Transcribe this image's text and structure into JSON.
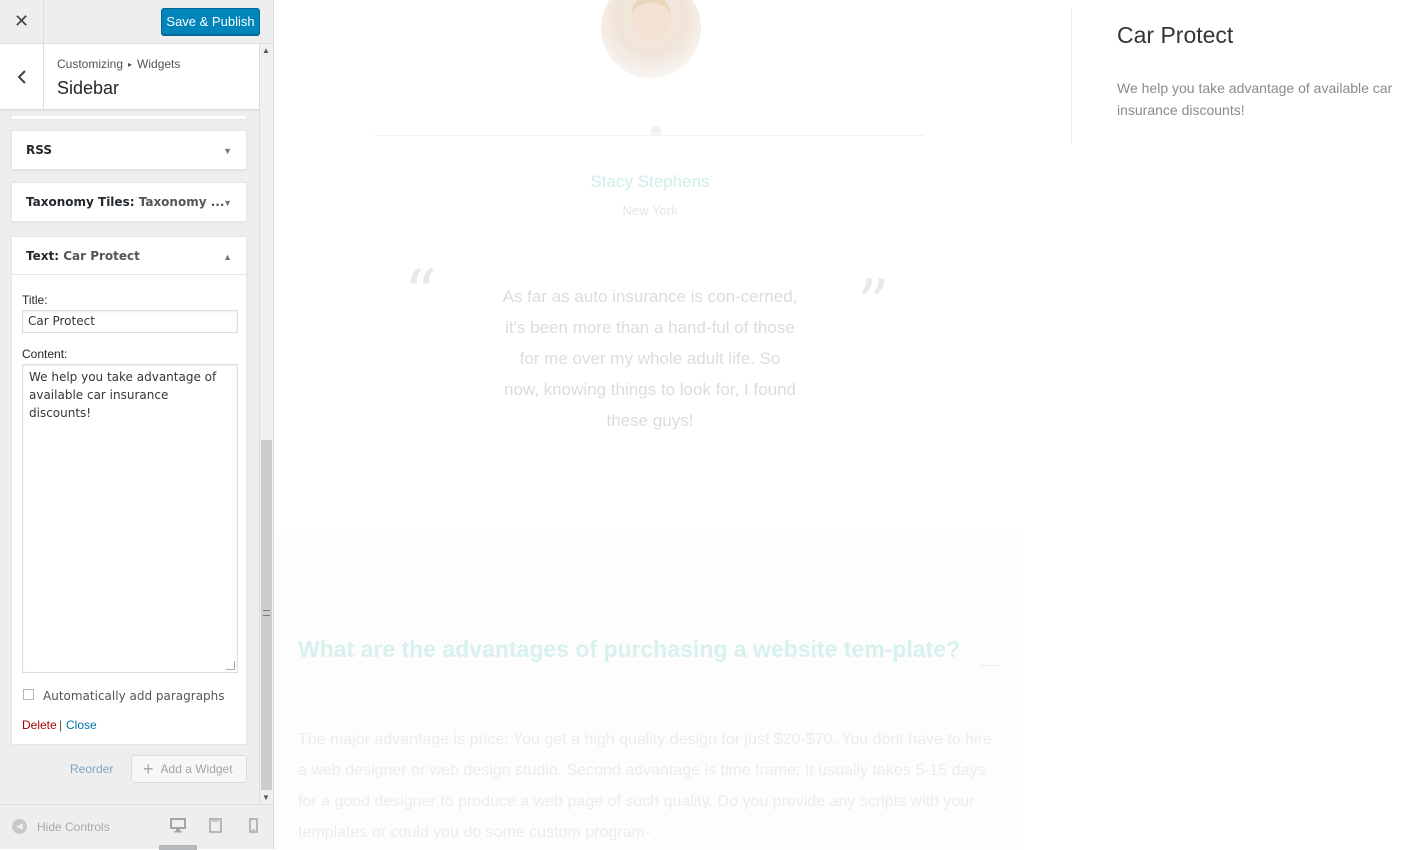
{
  "topbar": {
    "close_icon": "close-icon",
    "save_label": "Save & Publish"
  },
  "section": {
    "breadcrumb_parent": "Customizing",
    "breadcrumb_child": "Widgets",
    "title": "Sidebar"
  },
  "widgets": [
    {
      "type": "RSS",
      "instance": ""
    },
    {
      "type": "Taxonomy Tiles",
      "instance": "Taxonomy ..."
    },
    {
      "type": "Text",
      "instance": "Car Protect"
    }
  ],
  "text_widget": {
    "title_label": "Title:",
    "title_value": "Car Protect",
    "content_label": "Content:",
    "content_value": "We help you take advantage of available car insurance discounts!",
    "auto_paragraphs_label": "Automatically add paragraphs",
    "auto_paragraphs_checked": false,
    "delete_label": "Delete",
    "separator": "|",
    "close_label": "Close"
  },
  "actions": {
    "reorder_label": "Reorder",
    "add_widget_label": "Add a Widget"
  },
  "footer": {
    "hide_controls_label": "Hide Controls",
    "active_device": "desktop"
  },
  "preview": {
    "testimonial": {
      "name": "Stacy Stephens",
      "city": "New York",
      "quote": "As far as auto insurance is con-cerned, it's been more than a hand-ful of those for me over my whole adult life. So now, knowing things to look for, I found these guys!"
    },
    "faq": {
      "question": "What are the advantages of purchasing a website tem-plate?",
      "answer": "The major advantage is price: You get a high quality design for just $20-$70. You dont have to hire a web designer or web design studio. Second advantage is time frame: It usually takes 5-15 days for a good designer to produce a web page of such quality. Do you provide any scripts with your templates or could you do some custom program-"
    },
    "sidebar_widget": {
      "title": "Car Protect",
      "text": "We help you take advantage of available car insurance discounts!"
    }
  },
  "colors": {
    "primary_button": "#0085ba",
    "accent_teal": "#cdeeea",
    "delete_link": "#aa0000",
    "link": "#0073aa"
  }
}
